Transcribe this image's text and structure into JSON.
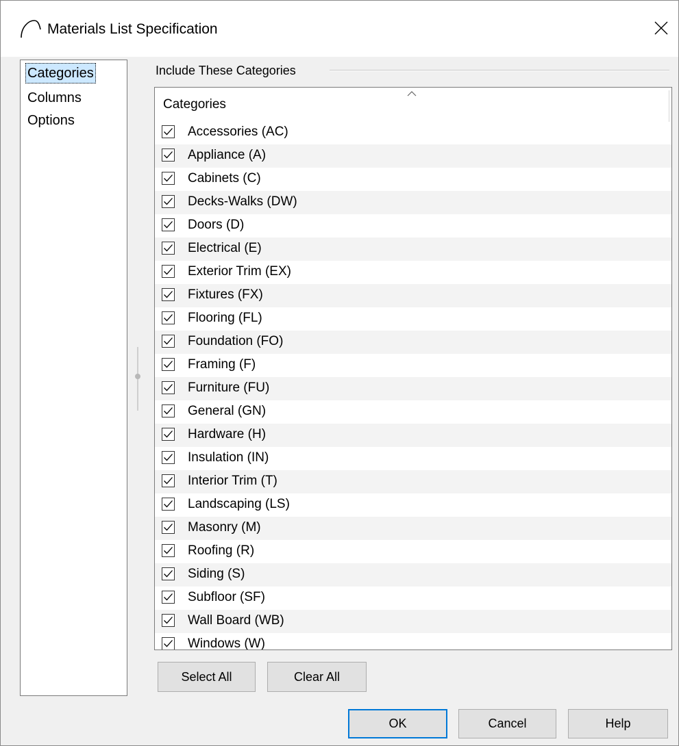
{
  "window": {
    "title": "Materials List Specification",
    "icon": "roof-arc-icon",
    "close_label": "close"
  },
  "nav": {
    "items": [
      {
        "label": "Categories",
        "selected": true
      },
      {
        "label": "Columns",
        "selected": false
      },
      {
        "label": "Options",
        "selected": false
      }
    ]
  },
  "group": {
    "label": "Include These Categories"
  },
  "list": {
    "column_header": "Categories",
    "rows": [
      {
        "label": "Accessories (AC)",
        "checked": true
      },
      {
        "label": "Appliance (A)",
        "checked": true
      },
      {
        "label": "Cabinets (C)",
        "checked": true
      },
      {
        "label": "Decks-Walks (DW)",
        "checked": true
      },
      {
        "label": "Doors (D)",
        "checked": true
      },
      {
        "label": "Electrical (E)",
        "checked": true
      },
      {
        "label": "Exterior Trim (EX)",
        "checked": true
      },
      {
        "label": "Fixtures (FX)",
        "checked": true
      },
      {
        "label": "Flooring (FL)",
        "checked": true
      },
      {
        "label": "Foundation (FO)",
        "checked": true
      },
      {
        "label": "Framing (F)",
        "checked": true
      },
      {
        "label": "Furniture (FU)",
        "checked": true
      },
      {
        "label": "General (GN)",
        "checked": true
      },
      {
        "label": "Hardware (H)",
        "checked": true
      },
      {
        "label": "Insulation (IN)",
        "checked": true
      },
      {
        "label": "Interior Trim (T)",
        "checked": true
      },
      {
        "label": "Landscaping (LS)",
        "checked": true
      },
      {
        "label": "Masonry (M)",
        "checked": true
      },
      {
        "label": "Roofing (R)",
        "checked": true
      },
      {
        "label": "Siding (S)",
        "checked": true
      },
      {
        "label": "Subfloor (SF)",
        "checked": true
      },
      {
        "label": "Wall Board (WB)",
        "checked": true
      },
      {
        "label": "Windows (W)",
        "checked": true
      }
    ]
  },
  "buttons": {
    "select_all": "Select All",
    "clear_all": "Clear All",
    "ok": "OK",
    "cancel": "Cancel",
    "help": "Help"
  },
  "colors": {
    "accent": "#0078d7",
    "selection": "#cce8ff",
    "dialog_bg": "#f0f0f0"
  }
}
